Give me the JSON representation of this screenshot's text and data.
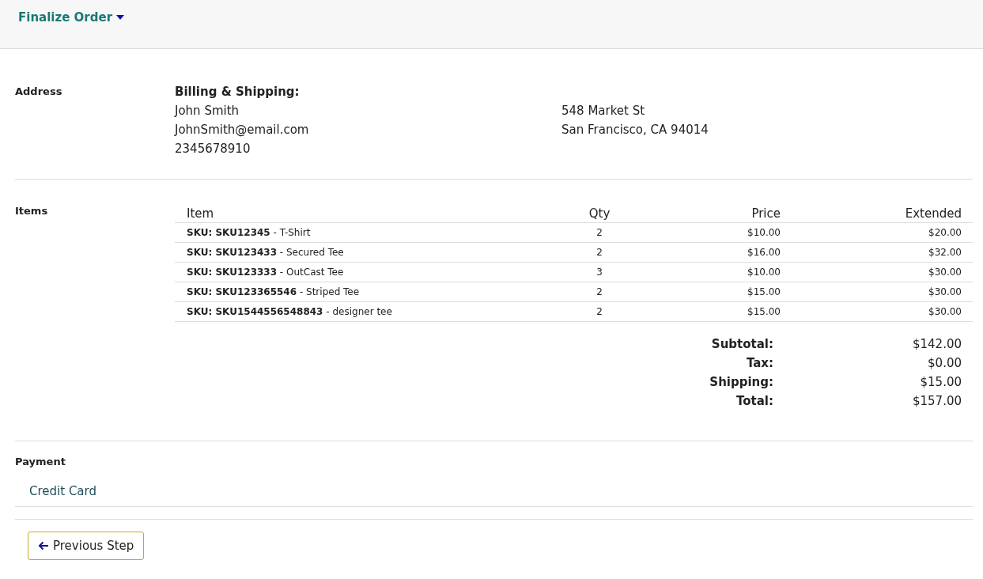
{
  "header": {
    "title": "Finalize Order"
  },
  "address": {
    "label": "Address",
    "heading": "Billing & Shipping:",
    "name": "John Smith",
    "email": "JohnSmith@email.com",
    "phone": "2345678910",
    "street": "548 Market St",
    "city": "San Francisco, CA 94014"
  },
  "items": {
    "label": "Items",
    "columns": [
      "Item",
      "Qty",
      "Price",
      "Extended"
    ],
    "rows": [
      {
        "item": "**SKU: SKU12345** - T-Shirt",
        "qty": "2",
        "price": "$10.00",
        "extended": "$20.00"
      },
      {
        "item": "**SKU: SKU123433** - Secured Tee",
        "qty": "2",
        "price": "$16.00",
        "extended": "$32.00"
      },
      {
        "item": "**SKU: SKU123333** - OutCast Tee",
        "qty": "3",
        "price": "$10.00",
        "extended": "$30.00"
      },
      {
        "item": "**SKU: SKU123365546** - Striped Tee",
        "qty": "2",
        "price": "$15.00",
        "extended": "$30.00"
      },
      {
        "item": "**SKU: SKU1544556548843** - designer tee",
        "qty": "2",
        "price": "$15.00",
        "extended": "$30.00"
      }
    ],
    "totals": [
      {
        "label": "Subtotal:",
        "value": "$142.00"
      },
      {
        "label": "Tax:",
        "value": "$0.00"
      },
      {
        "label": "Shipping:",
        "value": "$15.00"
      },
      {
        "label": "Total:",
        "value": "$157.00"
      }
    ]
  },
  "payment": {
    "label": "Payment",
    "method": "Credit Card"
  },
  "buttons": [
    {
      "label": "Previous Step"
    }
  ]
}
